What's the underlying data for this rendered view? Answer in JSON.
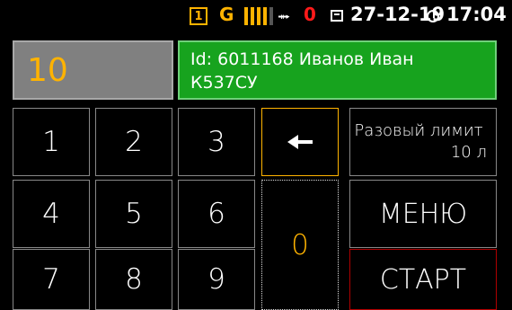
{
  "status_bar": {
    "sim_label": "1",
    "network_label": "G",
    "signal_level": "4/5",
    "usb_icon": "usb-icon",
    "usb_value": "0",
    "date": "27-12-19",
    "time": "17:04",
    "accent_color": "#ffb300",
    "alert_color": "#ff1a1a"
  },
  "quantity_display": {
    "value": "10"
  },
  "client_card": {
    "line1": "Id: 6011168  Иванов Иван",
    "line2": "К537СУ",
    "background_color": "#17a31e"
  },
  "keypad": {
    "keys": [
      "1",
      "2",
      "3",
      "4",
      "5",
      "6",
      "7",
      "8",
      "9"
    ],
    "zero": "0",
    "backspace_icon": "backspace-arrow-icon"
  },
  "buttons": {
    "limit_line1": "Разовый лимит",
    "limit_line2": "10 л",
    "menu": "МЕНЮ",
    "start": "СТАРТ"
  }
}
